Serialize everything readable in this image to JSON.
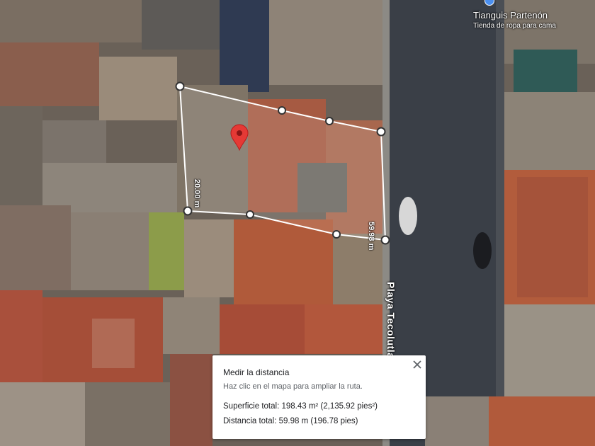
{
  "poi": {
    "name": "Tianguis Partenón",
    "subtitle": "Tienda de ropa para cama",
    "pin_color": "#4a8ff0"
  },
  "street": {
    "name": "Playa Tecolutla"
  },
  "segments": {
    "left": "20.00 m",
    "right": "59.98 m"
  },
  "marker": {
    "icon": "map-pin-icon",
    "color": "#e53935"
  },
  "panel": {
    "title": "Medir la distancia",
    "hint": "Haz clic en el mapa para ampliar la ruta.",
    "area": "Superficie total: 198.43 m² (2,135.92 pies²)",
    "distance": "Distancia total: 59.98 m (196.78 pies)",
    "close_icon": "close-icon"
  }
}
